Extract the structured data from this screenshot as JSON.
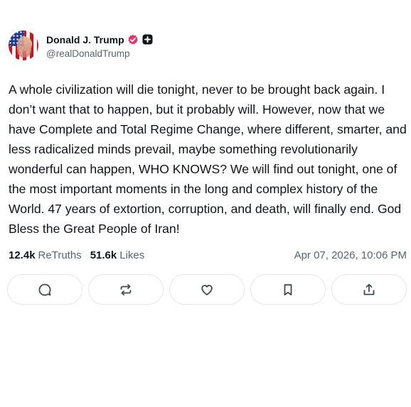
{
  "author": {
    "display_name": "Donald J. Trump",
    "handle": "@realDonaldTrump",
    "verified_color": "#e8336d"
  },
  "post": {
    "text": "A whole civilization will die tonight, never to be brought back again. I don’t want that to happen, but it probably will. However, now that we have Complete and Total Regime Change, where different, smarter, and less radicalized minds prevail, maybe something revolutionarily wonderful can happen, WHO KNOWS? We will find out tonight, one of the most important moments in the long and complex history of the World. 47 years of extortion, corruption, and death, will finally end. God Bless the Great People of Iran!"
  },
  "stats": {
    "retruths_count": "12.4k",
    "retruths_label": "ReTruths",
    "likes_count": "51.6k",
    "likes_label": "Likes",
    "timestamp": "Apr 07, 2026, 10:06 PM"
  },
  "actions": [
    {
      "icon": "reply-icon"
    },
    {
      "icon": "retruth-icon"
    },
    {
      "icon": "like-icon"
    },
    {
      "icon": "bookmark-icon"
    },
    {
      "icon": "share-icon"
    }
  ]
}
